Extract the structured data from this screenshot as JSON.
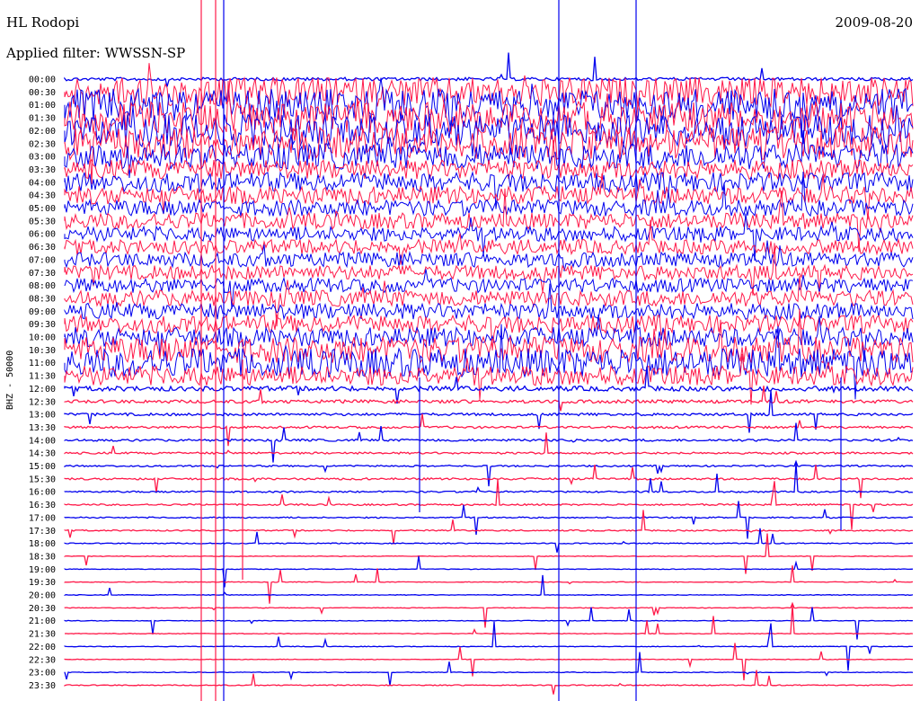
{
  "header": {
    "station": "HL Rodopi",
    "filter": "Applied filter: WWSSN-SP",
    "date": "2009-08-20"
  },
  "colors": {
    "trace_a": "#0000ee",
    "trace_b": "#ff1a4a",
    "background": "#ffffff",
    "text": "#000000"
  },
  "chart_data": {
    "type": "line",
    "title": "HL Rodopi",
    "subtitle": "Applied filter: WWSSN-SP",
    "date": "2009-08-20",
    "ylabel": "BHZ - 50000",
    "xlabel": "",
    "grid": false,
    "color_alternation": [
      "blue",
      "red"
    ],
    "rows": [
      {
        "time": "00:00",
        "level": 0.1
      },
      {
        "time": "00:30",
        "level": 0.9
      },
      {
        "time": "01:00",
        "level": 1.0
      },
      {
        "time": "01:30",
        "level": 1.0
      },
      {
        "time": "02:00",
        "level": 1.0
      },
      {
        "time": "02:30",
        "level": 1.0
      },
      {
        "time": "03:00",
        "level": 0.8
      },
      {
        "time": "03:30",
        "level": 0.6
      },
      {
        "time": "04:00",
        "level": 0.6
      },
      {
        "time": "04:30",
        "level": 0.55
      },
      {
        "time": "05:00",
        "level": 0.5
      },
      {
        "time": "05:30",
        "level": 0.5
      },
      {
        "time": "06:00",
        "level": 0.45
      },
      {
        "time": "06:30",
        "level": 0.45
      },
      {
        "time": "07:00",
        "level": 0.45
      },
      {
        "time": "07:30",
        "level": 0.45
      },
      {
        "time": "08:00",
        "level": 0.45
      },
      {
        "time": "08:30",
        "level": 0.5
      },
      {
        "time": "09:00",
        "level": 0.5
      },
      {
        "time": "09:30",
        "level": 0.55
      },
      {
        "time": "10:00",
        "level": 0.6
      },
      {
        "time": "10:30",
        "level": 0.8
      },
      {
        "time": "11:00",
        "level": 0.9
      },
      {
        "time": "11:30",
        "level": 0.6
      },
      {
        "time": "12:00",
        "level": 0.15
      },
      {
        "time": "12:30",
        "level": 0.1
      },
      {
        "time": "13:00",
        "level": 0.08
      },
      {
        "time": "13:30",
        "level": 0.07
      },
      {
        "time": "14:00",
        "level": 0.07
      },
      {
        "time": "14:30",
        "level": 0.06
      },
      {
        "time": "15:00",
        "level": 0.05
      },
      {
        "time": "15:30",
        "level": 0.06
      },
      {
        "time": "16:00",
        "level": 0.05
      },
      {
        "time": "16:30",
        "level": 0.05
      },
      {
        "time": "17:00",
        "level": 0.04
      },
      {
        "time": "17:30",
        "level": 0.04
      },
      {
        "time": "18:00",
        "level": 0.03
      },
      {
        "time": "18:30",
        "level": 0.02
      },
      {
        "time": "19:00",
        "level": 0.02
      },
      {
        "time": "19:30",
        "level": 0.02
      },
      {
        "time": "20:00",
        "level": 0.02
      },
      {
        "time": "20:30",
        "level": 0.02
      },
      {
        "time": "21:00",
        "level": 0.02
      },
      {
        "time": "21:30",
        "level": 0.02
      },
      {
        "time": "22:00",
        "level": 0.02
      },
      {
        "time": "22:30",
        "level": 0.02
      },
      {
        "time": "23:00",
        "level": 0.02
      },
      {
        "time": "23:30",
        "level": 0.03
      }
    ]
  }
}
